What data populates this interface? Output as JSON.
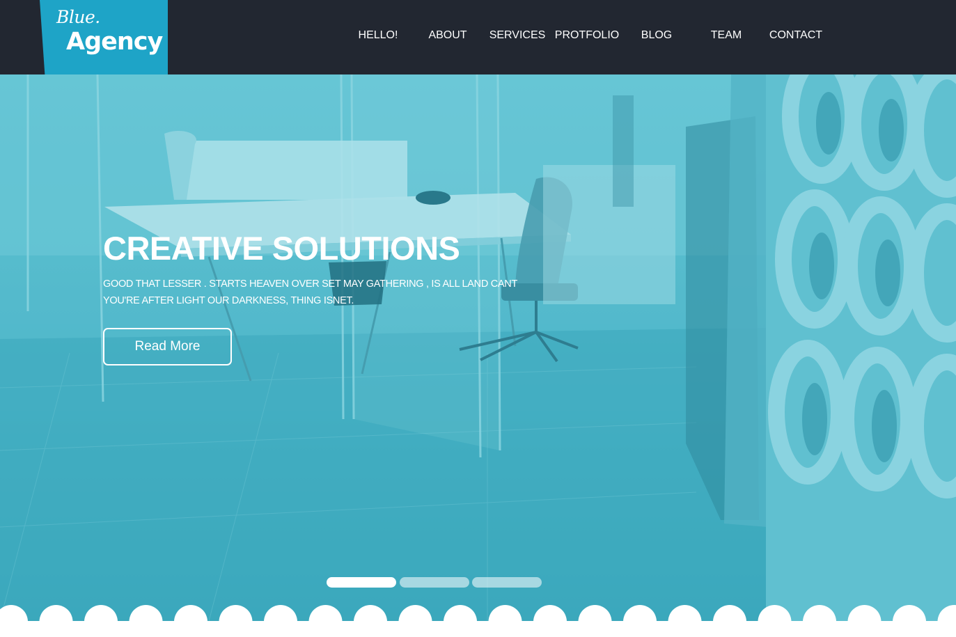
{
  "header": {
    "logo": {
      "script": "Blue.",
      "main": "Agency"
    },
    "nav": [
      {
        "label": "HELLO!"
      },
      {
        "label": "ABOUT"
      },
      {
        "label": "SERVICES"
      },
      {
        "label": "PROTFOLIO"
      },
      {
        "label": "BLOG"
      },
      {
        "label": "TEAM"
      },
      {
        "label": "CONTACT"
      }
    ]
  },
  "hero": {
    "title": "CREATIVE SOLUTIONS",
    "description": "GOOD THAT LESSER . STARTS HEAVEN OVER SET MAY GATHERING , IS ALL LAND CANT YOU'RE AFTER LIGHT OUR DARKNESS, THING ISNET.",
    "button_label": "Read More",
    "slider": {
      "total": 3,
      "active": 1
    }
  },
  "colors": {
    "header_bg": "#222731",
    "brand": "#1ea4c7",
    "hero_tint": "#5dbccd",
    "text": "#ffffff"
  }
}
